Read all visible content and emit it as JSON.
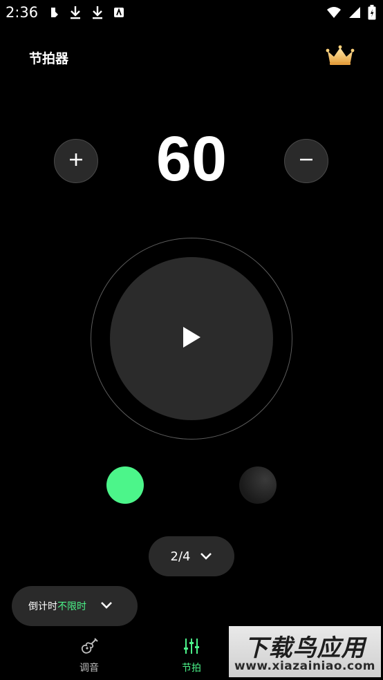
{
  "status_bar": {
    "time": "2:36",
    "left_icons": [
      "notification-icon",
      "download-icon",
      "download-icon",
      "app-icon"
    ],
    "right_icons": [
      "wifi-icon",
      "signal-icon",
      "battery-icon"
    ]
  },
  "header": {
    "title": "节拍器",
    "premium_icon": "crown-icon"
  },
  "tempo": {
    "value": "60",
    "increase_icon": "plus-icon",
    "decrease_icon": "minus-icon"
  },
  "player": {
    "play_icon": "play-icon"
  },
  "beats": {
    "count": 2,
    "active_index": 0,
    "active_color": "#4cf58a"
  },
  "time_signature": {
    "value": "2/4"
  },
  "countdown": {
    "label": "倒计时",
    "value": "不限时"
  },
  "bottom_nav": {
    "tuner_label": "调音",
    "metronome_label": "节拍",
    "active": "节拍"
  },
  "watermark": {
    "text": "下载鸟应用",
    "url": "www.xiazainiao.com"
  },
  "colors": {
    "accent": "#4cf58a",
    "background": "#000000",
    "surface": "#2a2a2a"
  }
}
